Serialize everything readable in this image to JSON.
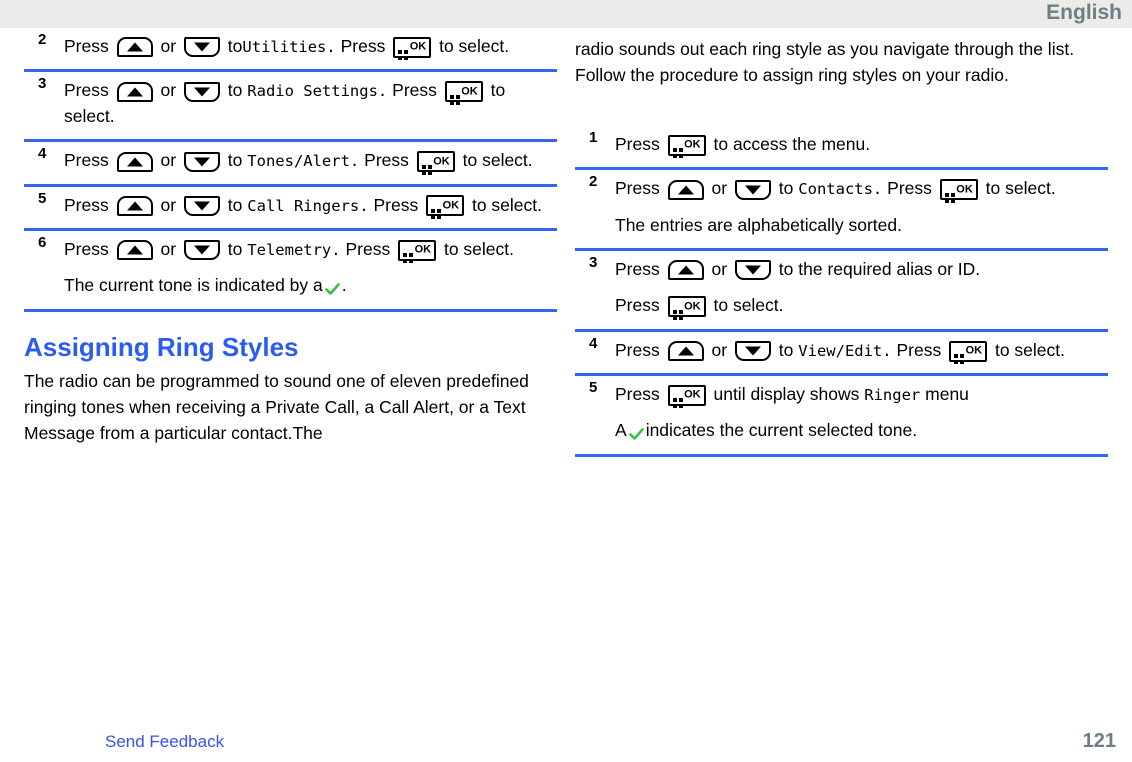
{
  "header": {
    "language": "English"
  },
  "icons": {
    "up": "arrow-up-button-icon",
    "down": "arrow-down-button-icon",
    "ok": "menu-ok-button-icon",
    "ok_label": "OK",
    "check": "green-checkmark-icon"
  },
  "colors": {
    "heading": "#2b5cf0",
    "divider": "#3366ee",
    "link": "#3a50f0",
    "header_text": "#6b7f85",
    "header_bg": "#ebebea",
    "check": "#35c138"
  },
  "left_column": {
    "steps": [
      {
        "number": "2",
        "prefix": "Press",
        "conjunction": "or",
        "to": "to",
        "menu": "Utilities.",
        "press2": "Press",
        "suffix": "to select."
      },
      {
        "number": "3",
        "prefix": "Press",
        "conjunction": "or",
        "to": "to",
        "menu": "Radio Settings.",
        "press2": "Press",
        "suffix": "to select."
      },
      {
        "number": "4",
        "prefix": "Press",
        "conjunction": "or",
        "to": "to",
        "menu": "Tones/Alert.",
        "press2": "Press",
        "suffix": "to select."
      },
      {
        "number": "5",
        "prefix": "Press",
        "conjunction": "or",
        "to": "to",
        "menu": "Call Ringers.",
        "press2": "Press",
        "suffix": "to select."
      },
      {
        "number": "6",
        "prefix": "Press",
        "conjunction": "or",
        "to": "to",
        "menu": "Telemetry.",
        "press2": "Press",
        "suffix": "to select.",
        "note_before": "The current tone is indicated by a",
        "note_after": "."
      }
    ],
    "heading": "Assigning Ring Styles",
    "paragraph": "The radio can be programmed to sound one of eleven predefined ringing tones when receiving a Private Call, a Call Alert, or a Text Message from a particular contact.The"
  },
  "right_column": {
    "paragraph": "radio sounds out each ring style as you navigate through the list. Follow the procedure to assign ring styles on your radio.",
    "steps": [
      {
        "number": "1",
        "prefix": "Press",
        "suffix": "to access the menu."
      },
      {
        "number": "2",
        "prefix": "Press",
        "conjunction": "or",
        "to": "to",
        "menu": "Contacts.",
        "press2": "Press",
        "suffix": "to select.",
        "note": "The entries are alphabetically sorted."
      },
      {
        "number": "3",
        "prefix": "Press",
        "conjunction": "or",
        "to": "to the required alias or ID.",
        "press2": "Press",
        "suffix": "to select."
      },
      {
        "number": "4",
        "prefix": "Press",
        "conjunction": "or",
        "to": "to",
        "menu": "View/Edit.",
        "press2": "Press",
        "suffix": "to select."
      },
      {
        "number": "5",
        "prefix": "Press",
        "middle": "until display shows",
        "menu": "Ringer",
        "suffix": "menu",
        "note_before": "A",
        "note_after": "indicates the current selected tone."
      }
    ]
  },
  "footer": {
    "feedback": "Send Feedback",
    "page_number": "121"
  }
}
